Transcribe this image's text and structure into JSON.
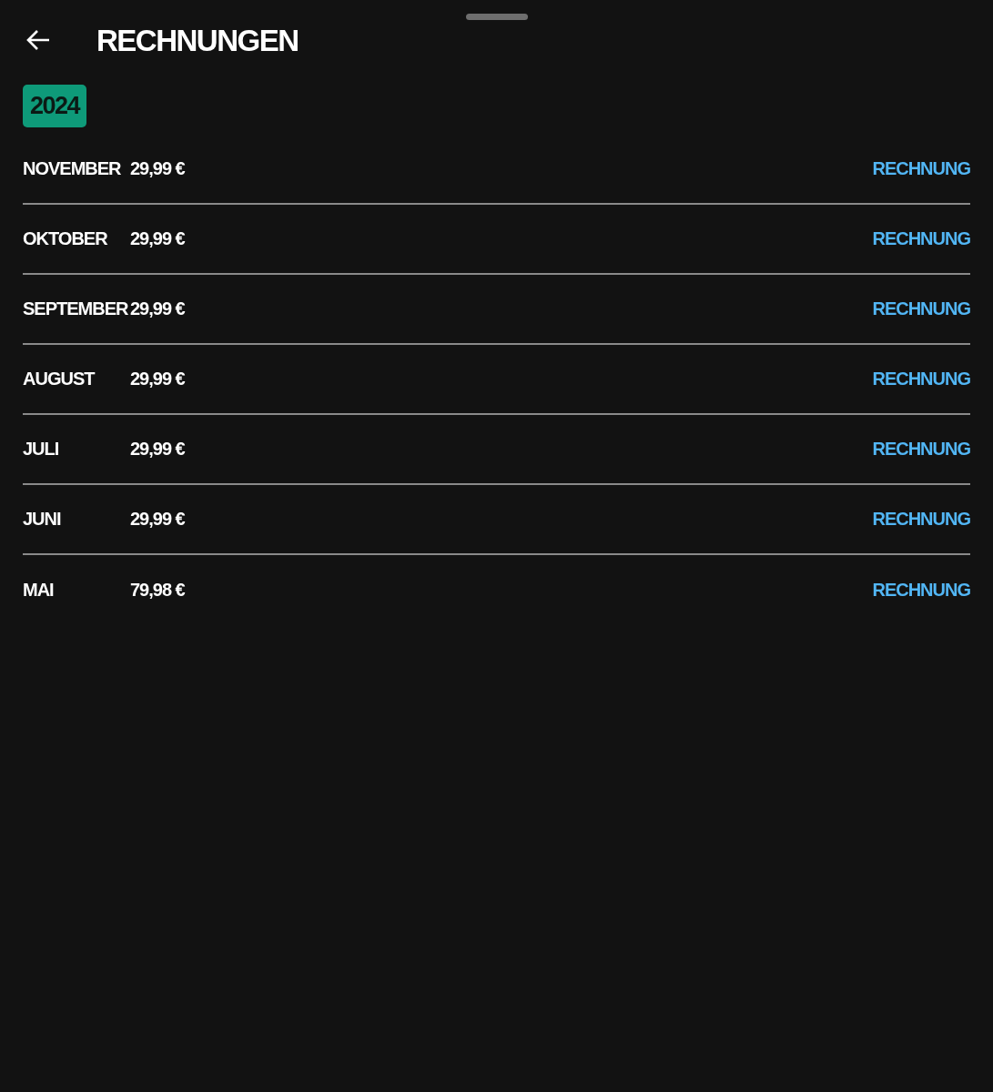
{
  "header": {
    "title": "RECHNUNGEN"
  },
  "year": {
    "label": "2024",
    "selected": true
  },
  "invoices": [
    {
      "month": "NOVEMBER",
      "amount": "29,99 €",
      "link": "RECHNUNG"
    },
    {
      "month": "OKTOBER",
      "amount": "29,99 €",
      "link": "RECHNUNG"
    },
    {
      "month": "SEPTEMBER",
      "amount": "29,99 €",
      "link": "RECHNUNG"
    },
    {
      "month": "AUGUST",
      "amount": "29,99 €",
      "link": "RECHNUNG"
    },
    {
      "month": "JULI",
      "amount": "29,99 €",
      "link": "RECHNUNG"
    },
    {
      "month": "JUNI",
      "amount": "29,99 €",
      "link": "RECHNUNG"
    },
    {
      "month": "MAI",
      "amount": "79,98 €",
      "link": "RECHNUNG"
    }
  ]
}
